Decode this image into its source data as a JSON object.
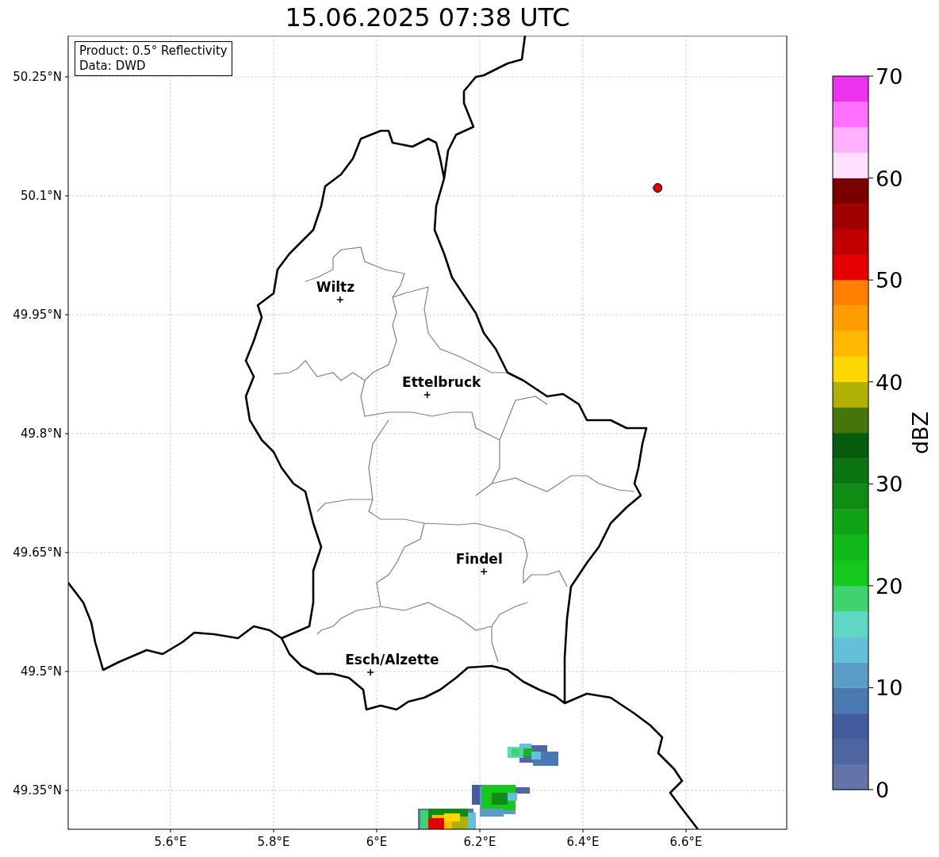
{
  "title": "15.06.2025 07:38 UTC",
  "info_box": [
    "Product: 0.5° Reflectivity",
    "Data: DWD"
  ],
  "xticks": [
    "5.6°E",
    "5.8°E",
    "6°E",
    "6.2°E",
    "6.4°E",
    "6.6°E"
  ],
  "yticks": [
    "50.25°N",
    "50.1°N",
    "49.95°N",
    "49.8°N",
    "49.65°N",
    "49.5°N",
    "49.35°N"
  ],
  "cities": [
    {
      "name": "Wiltz"
    },
    {
      "name": "Ettelbruck"
    },
    {
      "name": "Findel"
    },
    {
      "name": "Esch/Alzette"
    }
  ],
  "colorbar": {
    "label": "dBZ",
    "ticks": [
      "70",
      "60",
      "50",
      "40",
      "30",
      "20",
      "10",
      "0"
    ],
    "bins": [
      {
        "color": "#6574a8"
      },
      {
        "color": "#4f67a0"
      },
      {
        "color": "#435c9e"
      },
      {
        "color": "#4a78b0"
      },
      {
        "color": "#5a9ec8"
      },
      {
        "color": "#63c0d8"
      },
      {
        "color": "#5fd7c4"
      },
      {
        "color": "#3ed36e"
      },
      {
        "color": "#14c81e"
      },
      {
        "color": "#10b81a"
      },
      {
        "color": "#0fa416"
      },
      {
        "color": "#0e8c14"
      },
      {
        "color": "#0b7512"
      },
      {
        "color": "#075d0e"
      },
      {
        "color": "#45760c"
      },
      {
        "color": "#b0b005"
      },
      {
        "color": "#ffd700"
      },
      {
        "color": "#ffb800"
      },
      {
        "color": "#ff9c00"
      },
      {
        "color": "#ff7f00"
      },
      {
        "color": "#e60000"
      },
      {
        "color": "#c00000"
      },
      {
        "color": "#a00000"
      },
      {
        "color": "#7a0000"
      },
      {
        "color": "#ffe0ff"
      },
      {
        "color": "#ffb0ff"
      },
      {
        "color": "#ff70ff"
      },
      {
        "color": "#ee33ee"
      }
    ]
  }
}
